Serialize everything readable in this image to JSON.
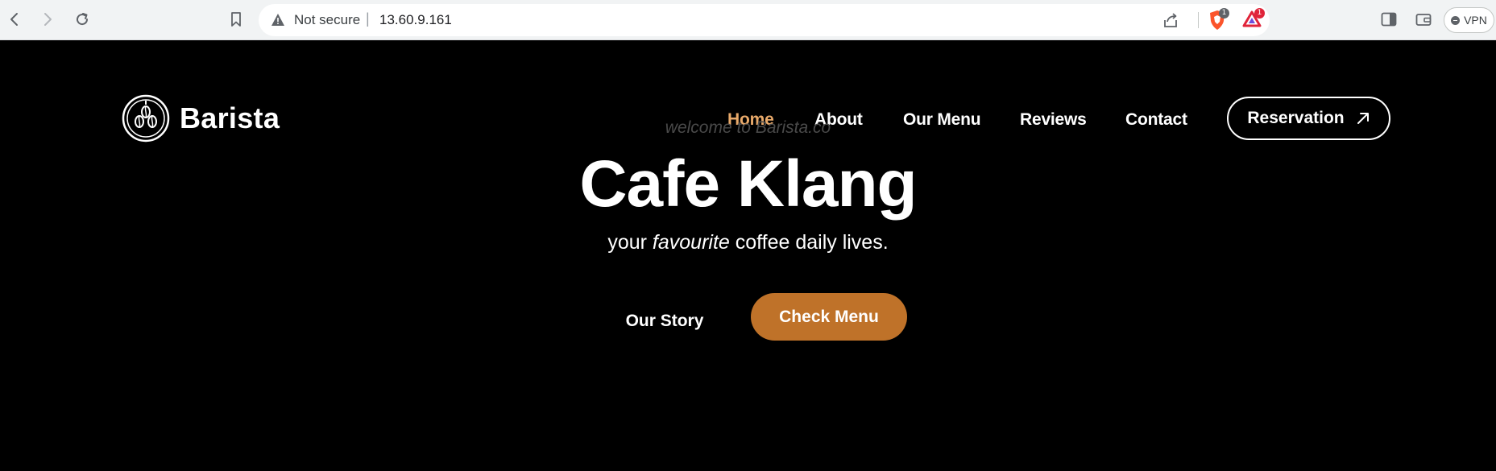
{
  "browser": {
    "security_label": "Not secure",
    "separator": "|",
    "url": "13.60.9.161",
    "shields_badge": "1",
    "rewards_badge": "1",
    "vpn_label": "VPN",
    "brave_color": "#fb542b",
    "rewards_color": "#e0243a"
  },
  "site": {
    "brand": "Barista",
    "nav": [
      {
        "label": "Home",
        "active": true
      },
      {
        "label": "About",
        "active": false
      },
      {
        "label": "Our Menu",
        "active": false
      },
      {
        "label": "Reviews",
        "active": false
      },
      {
        "label": "Contact",
        "active": false
      }
    ],
    "reservation_label": "Reservation",
    "reservation_icon": "arrow-up-right-icon",
    "hero": {
      "welcome": "welcome to Barista.co",
      "title": "Cafe Klang",
      "subtitle_before": "your ",
      "subtitle_em": "favourite",
      "subtitle_after": " coffee daily lives."
    },
    "our_story_label": "Our Story",
    "check_menu_label": "Check Menu",
    "accent_color": "#bf7229",
    "active_nav_color": "#e8a96a"
  }
}
